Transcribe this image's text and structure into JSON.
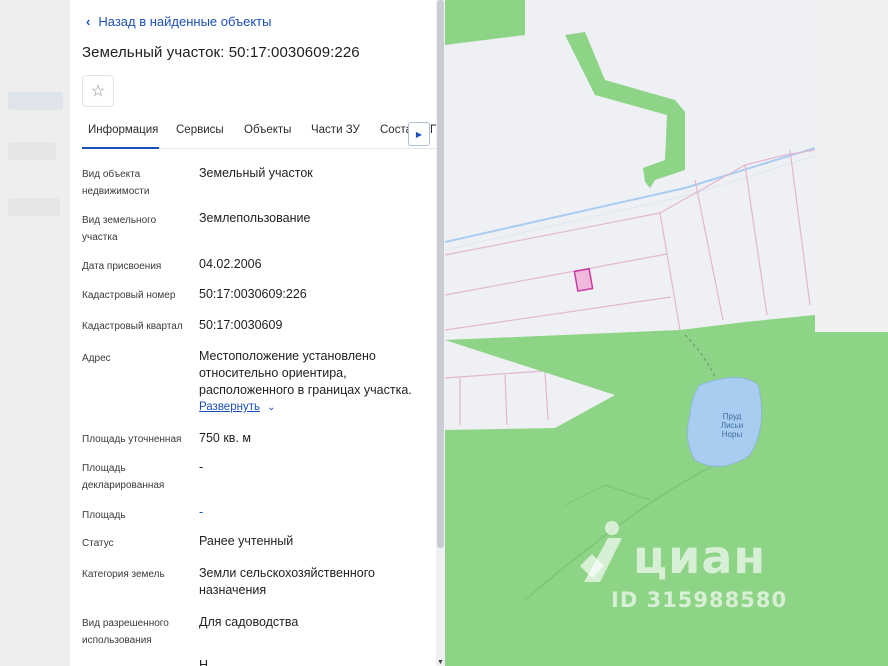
{
  "header": {
    "back_label": "Назад в найденные объекты",
    "title": "Земельный участок: 50:17:0030609:226"
  },
  "tabs": [
    {
      "label": "Информация"
    },
    {
      "label": "Сервисы"
    },
    {
      "label": "Объекты"
    },
    {
      "label": "Части ЗУ"
    },
    {
      "label": "Соста"
    },
    {
      "label": "П"
    }
  ],
  "details": {
    "object_type": {
      "label": "Вид объекта недвижимости",
      "value": "Земельный участок"
    },
    "land_type": {
      "label": "Вид земельного участка",
      "value": "Землепользование"
    },
    "assigned_date": {
      "label": "Дата присвоения",
      "value": "04.02.2006"
    },
    "cadastral_number": {
      "label": "Кадастровый номер",
      "value": "50:17:0030609:226"
    },
    "cadastral_quarter": {
      "label": "Кадастровый квартал",
      "value": "50:17:0030609"
    },
    "address": {
      "label": "Адрес",
      "value": "Местоположение установлено относительно ориентира, расположенного в границах участка.",
      "expand_label": "Развернуть"
    },
    "area_refined": {
      "label": "Площадь уточненная",
      "value": "750 кв. м"
    },
    "area_declared": {
      "label": "Площадь декларированная",
      "value": "-"
    },
    "area": {
      "label": "Площадь",
      "value": "-"
    },
    "status": {
      "label": "Статус",
      "value": "Ранее учтенный"
    },
    "land_category": {
      "label": "Категория земель",
      "value": "Земли сельскохозяйственного назначения"
    },
    "permitted_use": {
      "label": "Вид разрешенного использования",
      "value": "Для садоводства"
    },
    "cutoff": {
      "value": "Н"
    }
  },
  "map": {
    "pond_label": "Пруд Лисьи Норы",
    "colors": {
      "forest": "#8ed486",
      "background": "#eef0f4",
      "parcel_line": "#e2b7cf",
      "highlight_parcel": "#c93aa0",
      "water": "#a9cdf0",
      "stream": "#a9cdf0"
    }
  },
  "watermark": {
    "brand": "циан",
    "listing_id": "ID 315988580"
  },
  "colors": {
    "accent": "#1c4fb8",
    "text": "#1f1f1f"
  }
}
